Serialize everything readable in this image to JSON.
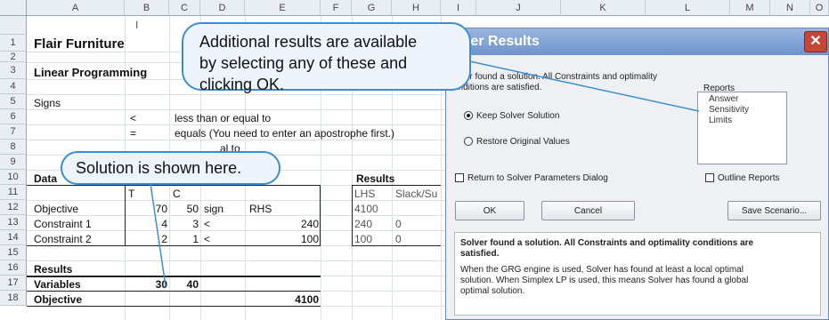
{
  "columns": [
    "A",
    "B",
    "C",
    "D",
    "E",
    "F",
    "G",
    "H",
    "I",
    "J",
    "K",
    "L",
    "M",
    "N",
    "O"
  ],
  "rows": [
    "1",
    "2",
    "3",
    "4",
    "5",
    "6",
    "7",
    "8",
    "9",
    "10",
    "11",
    "12",
    "13",
    "14",
    "15",
    "16",
    "17",
    "18"
  ],
  "sheet": {
    "title": "Flair Furniture",
    "section": "Linear Programming",
    "signs_label": "Signs",
    "sign_lt": "<",
    "sign_lt_desc": "less than or equal to",
    "sign_eq": "=",
    "sign_eq_desc": "equals (You need to enter an apostrophe first.)",
    "sign_gt_partial": "al to",
    "data_label": "Data",
    "hdr_T": "T",
    "hdr_C": "C",
    "results_hdr": "Results",
    "hdr_LHS": "LHS",
    "hdr_slack": "Slack/Su",
    "hdr_sign": "sign",
    "hdr_RHS": "RHS",
    "objective": {
      "label": "Objective",
      "t": "70",
      "c": "50",
      "lhs": "4100"
    },
    "c1": {
      "label": "Constraint 1",
      "t": "4",
      "c": "3",
      "sign": "<",
      "rhs": "240",
      "lhs": "240",
      "slack": "0"
    },
    "c2": {
      "label": "Constraint 2",
      "t": "2",
      "c": "1",
      "sign": "<",
      "rhs": "100",
      "lhs": "100",
      "slack": "0"
    },
    "results_label": "Results",
    "variables": {
      "label": "Variables",
      "t": "30",
      "c": "40"
    },
    "objective2": {
      "label": "Objective",
      "value": "4100"
    },
    "partial_B1": "I"
  },
  "dialog": {
    "title": "lver Results",
    "close": "✕",
    "status_line1": "olver found a solution.  All Constraints and optimality",
    "status_line2": "onditions are satisfied.",
    "reports_label": "Reports",
    "reports": [
      "Answer",
      "Sensitivity",
      "Limits"
    ],
    "keep_label": "Keep Solver Solution",
    "restore_label": "Restore Original Values",
    "return_label": "Return to Solver Parameters Dialog",
    "outline_label": "Outline Reports",
    "ok_label": "OK",
    "cancel_label": "Cancel",
    "save_label": "Save Scenario...",
    "msg_bold": "Solver found a solution.  All Constraints and optimality conditions are",
    "msg_bold2": "satisfied.",
    "msg1": "When the GRG engine is used, Solver has found at least a local optimal",
    "msg2": "solution. When Simplex LP is used, this means Solver has found a global",
    "msg3": "optimal solution."
  },
  "callouts": {
    "reports_l1": "Additional results are available",
    "reports_l2": "by selecting any of these and",
    "reports_l3": "clicking OK.",
    "solution": "Solution is shown here."
  },
  "colors": {
    "callout_border": "#3d8ed1",
    "callout_fill": "#eef4fb",
    "dialog_title": "#7b9dd1"
  }
}
